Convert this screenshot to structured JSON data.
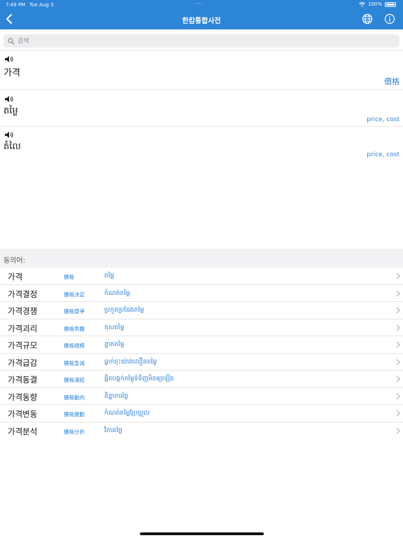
{
  "status_bar": {
    "time": "7:49 PM",
    "date": "Tue Aug 3",
    "battery": "100%"
  },
  "header": {
    "title": "한캄통합사전"
  },
  "search": {
    "placeholder": "검색"
  },
  "entries": [
    {
      "word": "가격",
      "meaning": "價格"
    },
    {
      "word": "តម្លៃ",
      "meaning": "price, cost"
    },
    {
      "word": "តំលៃ",
      "meaning": "price, cost"
    }
  ],
  "synonyms": {
    "header": "동의어:",
    "items": [
      {
        "ko": "가격",
        "hanja": "價格",
        "km": "តម្លៃ"
      },
      {
        "ko": "가격결정",
        "hanja": "價格決定",
        "km": "កំណត់តម្លៃ"
      },
      {
        "ko": "가격경쟁",
        "hanja": "價格競爭",
        "km": "ប្រកួតប្រជែងតម្លៃ"
      },
      {
        "ko": "가격괴리",
        "hanja": "價格乖離",
        "km": "ខុសតម្លៃ"
      },
      {
        "ko": "가격규모",
        "hanja": "價格規模",
        "km": "ខ្នាតតម្លៃ"
      },
      {
        "ko": "가격급감",
        "hanja": "價格急減",
        "km": "ធ្លាក់ចុះយ៉ាងលឿនតម្លៃ"
      },
      {
        "ko": "가격동결",
        "hanja": "價格凍結",
        "km": "ផ្អិតបង្កក់តម្លៃទំនិញមិនឲ្យឡើង"
      },
      {
        "ko": "가격동향",
        "hanja": "價格動向",
        "km": "និន្នាការថ្លៃ"
      },
      {
        "ko": "가격변동",
        "hanja": "價格變動",
        "km": "កំណត់តម្លៃប្រែប្រួល"
      },
      {
        "ko": "가격분석",
        "hanja": "價格分析",
        "km": "វិភាគថ្លៃ"
      }
    ]
  },
  "colors": {
    "accent": "#2d85d7",
    "background": "#ffffff",
    "separator": "#e6e6e6",
    "section_bg": "#f2f2f4"
  }
}
